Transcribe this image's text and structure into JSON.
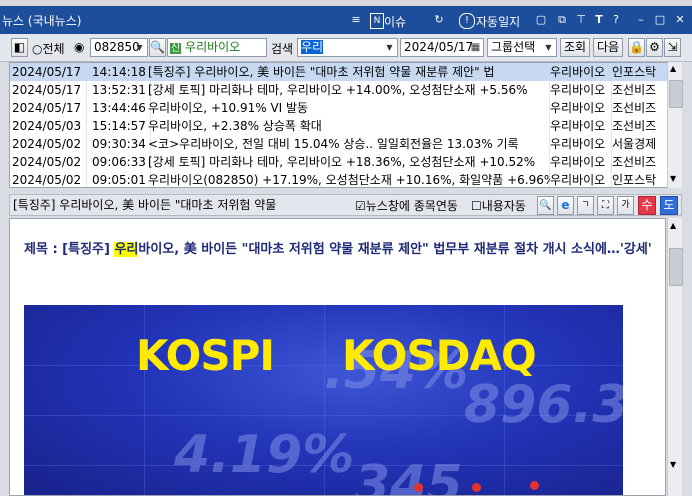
{
  "window": {
    "title": "뉴스 (국내뉴스)",
    "issue_label": "이슈",
    "auto_log_label": "자동일지"
  },
  "toolbar": {
    "radio_all": "전체",
    "stock_code": "082850",
    "stock_badge": "신",
    "stock_name": "우리바이오",
    "search_label": "검색",
    "search_value": "우리",
    "date": "2024/05/17",
    "group_select": "그룹선택",
    "query_button": "조회",
    "next_button": "다음"
  },
  "news": [
    {
      "date": "2024/05/17",
      "time": "14:14:18",
      "title": "[특징주] 우리바이오, 美 바이든 \"대마초 저위험 약물 재분류 제안\" 법",
      "stock": "우리바이오",
      "source": "인포스탁"
    },
    {
      "date": "2024/05/17",
      "time": "13:52:31",
      "title": "[강세 토픽] 마리화나 테마, 우리바이오 +14.00%, 오성첨단소재 +5.56%",
      "stock": "우리바이오",
      "source": "조선비즈"
    },
    {
      "date": "2024/05/17",
      "time": "13:44:46",
      "title": "우리바이오, +10.91% VI 발동",
      "stock": "우리바이오",
      "source": "조선비즈"
    },
    {
      "date": "2024/05/03",
      "time": "15:14:57",
      "title": "우리바이오, +2.38% 상승폭 확대",
      "stock": "우리바이오",
      "source": "조선비즈"
    },
    {
      "date": "2024/05/02",
      "time": "09:30:34",
      "title": "<코>우리바이오, 전일 대비 15.04% 상승.. 일일회전율은 13.03% 기록",
      "stock": "우리바이오",
      "source": "서울경제"
    },
    {
      "date": "2024/05/02",
      "time": "09:06:33",
      "title": "[강세 토픽] 마리화나 테마, 우리바이오 +18.36%, 오성첨단소재 +10.52%",
      "stock": "우리바이오",
      "source": "조선비즈"
    },
    {
      "date": "2024/05/02",
      "time": "09:05:01",
      "title": "우리바이오(082850)  +17.19%, 오성첨단소재 +10.16%, 화일약품 +6.96%,",
      "stock": "우리바이오",
      "source": "인포스탁"
    }
  ],
  "article_bar": {
    "headline": "[특징주] 우리바이오, 美 바이든 \"대마초 저위험 약물",
    "link_checkbox": "뉴스창에 종목연동",
    "auto_checkbox": "내용자동",
    "font_up": "가",
    "font_down": "가",
    "number_button": "수",
    "extra_button": "도"
  },
  "article": {
    "title_prefix": "제목 : [특징주] ",
    "title_highlight": "우리",
    "title_rest": "바이오, 美 바이든 \"대마초 저위험 약물 재분류 제안\" 법무부 재분류 절차 개시 소식에…'강세'",
    "image_text_left": "KOSPI",
    "image_text_right": "KOSDAQ"
  },
  "colors": {
    "titlebar": "#1d4e9b",
    "selected_row": "#c6d9f0",
    "article_title": "#1e2a78",
    "highlight": "#ffff00",
    "kospi_text": "#ffea00"
  }
}
